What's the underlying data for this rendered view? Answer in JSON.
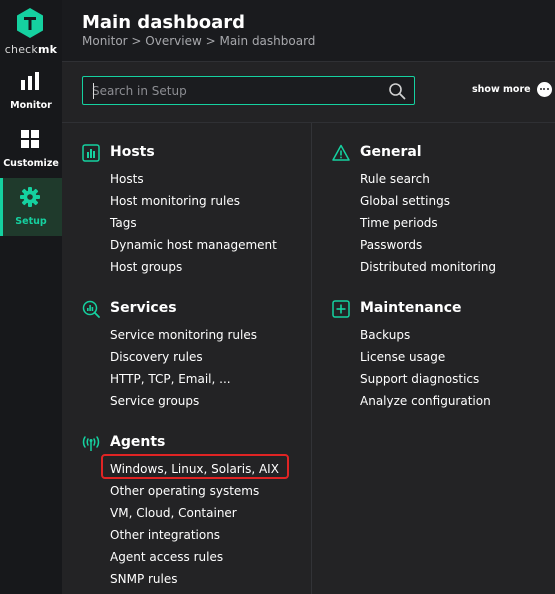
{
  "brand": {
    "name_light": "check",
    "name_bold": "mk",
    "accent": "#15d1a0"
  },
  "nav": {
    "items": [
      {
        "label": "Monitor",
        "icon": "bar-chart-icon"
      },
      {
        "label": "Customize",
        "icon": "grid-icon"
      },
      {
        "label": "Setup",
        "icon": "gear-icon",
        "active": true
      }
    ]
  },
  "header": {
    "title": "Main dashboard",
    "breadcrumb": "Monitor > Overview > Main dashboard"
  },
  "search": {
    "placeholder": "Search in Setup",
    "value": ""
  },
  "show_more": {
    "label": "show more"
  },
  "sections": {
    "hosts": {
      "title": "Hosts",
      "icon": "hosts-icon",
      "links": [
        "Hosts",
        "Host monitoring rules",
        "Tags",
        "Dynamic host management",
        "Host groups"
      ]
    },
    "services": {
      "title": "Services",
      "icon": "services-icon",
      "links": [
        "Service monitoring rules",
        "Discovery rules",
        "HTTP, TCP, Email, ...",
        "Service groups"
      ]
    },
    "agents": {
      "title": "Agents",
      "icon": "agents-icon",
      "links": [
        "Windows, Linux, Solaris, AIX",
        "Other operating systems",
        "VM, Cloud, Container",
        "Other integrations",
        "Agent access rules",
        "SNMP rules"
      ]
    },
    "general": {
      "title": "General",
      "icon": "warning-triangle-icon",
      "links": [
        "Rule search",
        "Global settings",
        "Time periods",
        "Passwords",
        "Distributed monitoring"
      ]
    },
    "maintenance": {
      "title": "Maintenance",
      "icon": "plus-box-icon",
      "links": [
        "Backups",
        "License usage",
        "Support diagnostics",
        "Analyze configuration"
      ]
    }
  },
  "highlight_color": "#e02424"
}
